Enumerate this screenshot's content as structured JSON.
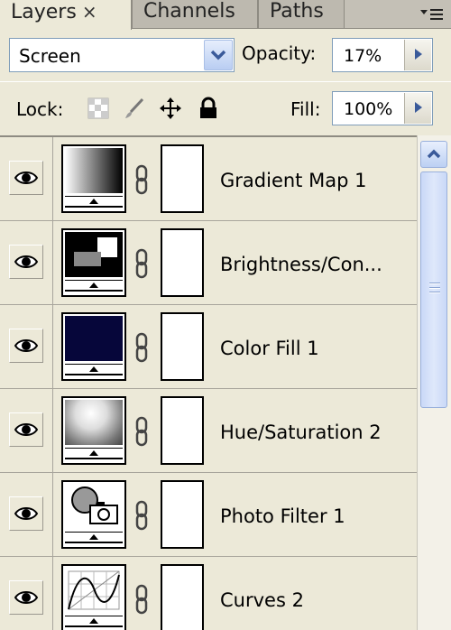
{
  "tabs": [
    {
      "label": "Layers",
      "active": true
    },
    {
      "label": "Channels",
      "active": false
    },
    {
      "label": "Paths",
      "active": false
    }
  ],
  "close_glyph": "×",
  "blend_mode": "Screen",
  "opacity": {
    "label": "Opacity:",
    "value": "17%"
  },
  "lock": {
    "label": "Lock:",
    "icons": [
      "lock-transparent-icon",
      "lock-brush-icon",
      "lock-move-icon",
      "lock-all-icon"
    ]
  },
  "fill": {
    "label": "Fill:",
    "value": "100%"
  },
  "layers": [
    {
      "name": "Gradient Map 1",
      "visible": true,
      "thumb": "gradient-map"
    },
    {
      "name": "Brightness/Con...",
      "visible": true,
      "thumb": "brightness-contrast"
    },
    {
      "name": "Color Fill 1",
      "visible": true,
      "thumb": "color-fill",
      "fill_color": "#06063a"
    },
    {
      "name": "Hue/Saturation 2",
      "visible": true,
      "thumb": "hue-saturation"
    },
    {
      "name": "Photo Filter 1",
      "visible": true,
      "thumb": "photo-filter"
    },
    {
      "name": "Curves 2",
      "visible": true,
      "thumb": "curves"
    }
  ],
  "colors": {
    "accent": "#7f9db9",
    "panel_bg": "#ece9d8"
  }
}
